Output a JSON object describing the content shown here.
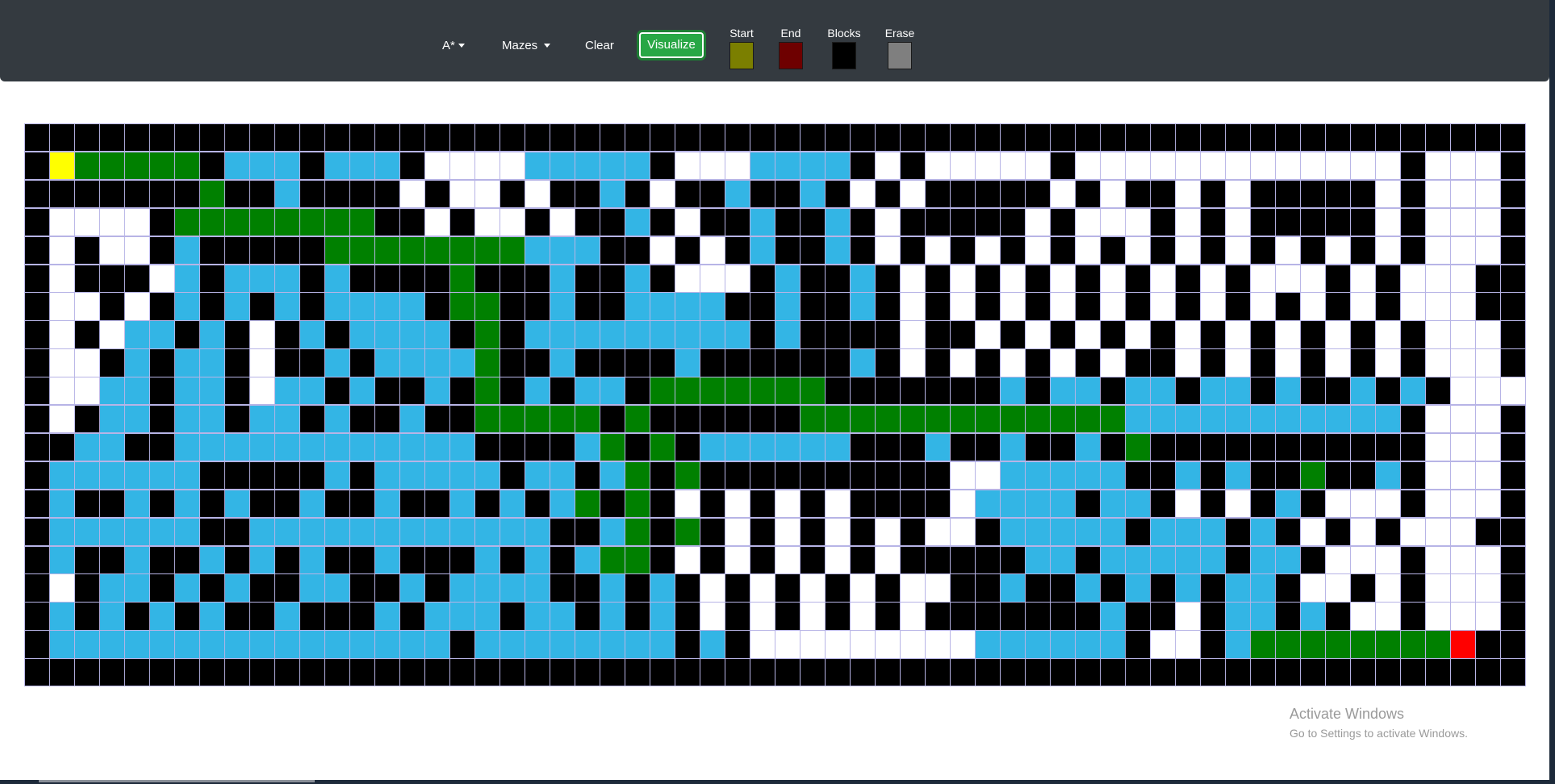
{
  "navbar": {
    "algorithm_label": "A*",
    "mazes_label": "Mazes",
    "clear_label": "Clear",
    "visualize_label": "Visualize"
  },
  "legend": [
    {
      "label": "Start",
      "color": "#7b7f00"
    },
    {
      "label": "End",
      "color": "#6e0000"
    },
    {
      "label": "Blocks",
      "color": "#000000"
    },
    {
      "label": "Erase",
      "color": "#7f7f7f"
    }
  ],
  "colors": {
    "wall": "#000000",
    "open": "#ffffff",
    "visited": "#33b5e5",
    "path": "#008000",
    "start": "#ffff00",
    "end": "#ff0000",
    "grid_line": "#b7b4e6",
    "navbar": "#343a40",
    "visualize": "#28a745"
  },
  "grid": {
    "cols": 60,
    "rows": 20,
    "legend_key": "# wall, . open, v visited, p path, S start, E end",
    "cells": [
      "############################################################",
      "#Sppppp#vvv#vvv#....vvvvv#...vvvv#.#.....#.............#...#",
      "#######p##v####.#..#.##v#.##v##v#.#.#####.#.##.#.#####.#...#",
      "#....#pppppppp##.#..#.##v#.##v##v#.#####.#...#.#.#####.#...#",
      "#.#..#v#####ppppppppvvv##.#.#v##v#.#.#.#.#.#.#.#.#.#.#.#...#",
      "#.###.v#vvv#v####p###v##v#...#v##v#.#.#.#.#.#.#.#...#.#...#",
      "#..#.#v#v#v#vvvv#pp##v##vvvv##v##v#.#.#.#.#.#.#.#.#.#.#...#",
      "#.#.vv#v#.#v#vvvv#p#vvvvvvvvv#v####.##.#.#.#.#.#.#.#.#.#...#",
      "#..#v#vv#.##v#vvvvp##v####v######v#.#.#.#.#.##.#.#.#.#.#...#",
      "#..vv#vv#.vv#v##v#p#v#vv#ppppppp#######v#vv#vv#vv#v##v#v#...",
      "#.#vv#vv#vv#v##v##ppppp#p######pppppppppppppvvvvvvvvvvv#...#",
      "##vv##vvvvvvvvvvvv####vp#p#vvvvvv###v##v##v#p###########...#",
      "#vvvvvv#####v#vvvvv#vv#vp#p##########..vvvvv##v#v##p##v#...#",
      "#v##v#v#v##v##v##v#v#vp#p#.#.#.#.####.vvvv#vv#.#.#v#...#...#",
      "#vvvvvv##vvvvvvvvvvvv##vp#p#.#.#.#.#..#vvvvv#vvv#v#.#.#...#",
      "#v##v##v#v#v##v###v#v#vpp#.#.#.#.#.#####vv#vvvvv#vv#...#...#",
      "#.#vv#v#v##vv##v#vvvv##v#v#.#.#.#.#..##v##v#v#v#vv#..#.#...#",
      "#v#v#v#v##v###v#vvv#vv#v#v#.#.#.#.#.#######v##.#vv#v#..#...#",
      "#vvvvvvvvvvvvvvvv#vvvvvvvv#v#.........vvvvvv#..#vppppppppE#",
      "############################################################"
    ]
  },
  "watermark": {
    "title": "Activate Windows",
    "subtitle": "Go to Settings to activate Windows."
  }
}
